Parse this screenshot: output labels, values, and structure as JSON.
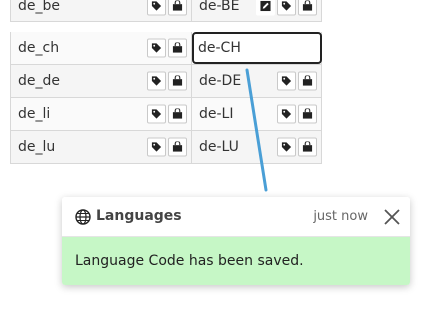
{
  "table": {
    "rows": [
      {
        "left": "de_be",
        "right": "de-BE"
      },
      {
        "left": "de_ch",
        "right_input": "de-CH"
      },
      {
        "left": "de_de",
        "right": "de-DE"
      },
      {
        "left": "de_li",
        "right": "de-LI"
      },
      {
        "left": "de_lu",
        "right": "de-LU"
      }
    ],
    "icons": [
      "tag-icon",
      "shop-icon",
      "edit-icon"
    ]
  },
  "toast": {
    "icon": "globe-icon",
    "title": "Languages",
    "time": "just now",
    "close_icon": "close-icon",
    "message": "Language Code has been saved.",
    "body_color": "#c6f7c6"
  },
  "colors": {
    "connector": "#4a9fd6"
  }
}
